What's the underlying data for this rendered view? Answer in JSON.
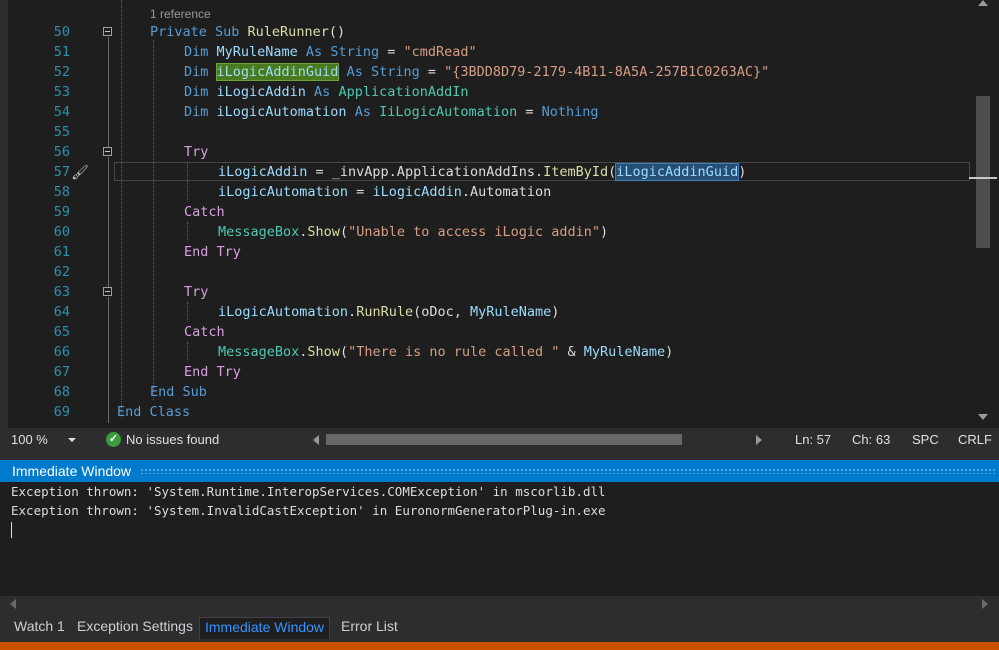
{
  "editor": {
    "reference_hint": "1 reference",
    "lines": [
      {
        "num": "50",
        "parts": [
          [
            "kw",
            "Private Sub "
          ],
          [
            "fn",
            "RuleRunner"
          ],
          [
            "plain",
            "()"
          ]
        ]
      },
      {
        "num": "51",
        "parts": [
          [
            "kw",
            "Dim "
          ],
          [
            "id",
            "MyRuleName"
          ],
          [
            "kw",
            " As "
          ],
          [
            "kw",
            "String"
          ],
          [
            "plain",
            " = "
          ],
          [
            "str",
            "\"cmdRead\""
          ]
        ]
      },
      {
        "num": "52",
        "parts": [
          [
            "kw",
            "Dim "
          ],
          [
            "id-hlg",
            "iLogicAddinGuid"
          ],
          [
            "kw",
            " As "
          ],
          [
            "kw",
            "String"
          ],
          [
            "plain",
            " = "
          ],
          [
            "str",
            "\"{3BDD8D79-2179-4B11-8A5A-257B1C0263AC}\""
          ]
        ]
      },
      {
        "num": "53",
        "parts": [
          [
            "kw",
            "Dim "
          ],
          [
            "id",
            "iLogicAddin"
          ],
          [
            "kw",
            " As "
          ],
          [
            "typ",
            "ApplicationAddIn"
          ]
        ]
      },
      {
        "num": "54",
        "parts": [
          [
            "kw",
            "Dim "
          ],
          [
            "id",
            "iLogicAutomation"
          ],
          [
            "kw",
            " As "
          ],
          [
            "typ",
            "IiLogicAutomation"
          ],
          [
            "plain",
            " = "
          ],
          [
            "kw",
            "Nothing"
          ]
        ]
      },
      {
        "num": "55",
        "parts": []
      },
      {
        "num": "56",
        "parts": [
          [
            "ctl",
            "Try"
          ]
        ]
      },
      {
        "num": "57",
        "parts": [
          [
            "id",
            "iLogicAddin"
          ],
          [
            "plain",
            " = _invApp.ApplicationAddIns."
          ],
          [
            "fn",
            "ItemById"
          ],
          [
            "plain",
            "("
          ],
          [
            "id-hlb",
            "iLogicAddinGuid"
          ],
          [
            "plain",
            ")"
          ]
        ]
      },
      {
        "num": "58",
        "parts": [
          [
            "id",
            "iLogicAutomation"
          ],
          [
            "plain",
            " = "
          ],
          [
            "id",
            "iLogicAddin"
          ],
          [
            "plain",
            ".Automation"
          ]
        ]
      },
      {
        "num": "59",
        "parts": [
          [
            "ctl",
            "Catch"
          ]
        ]
      },
      {
        "num": "60",
        "parts": [
          [
            "typ",
            "MessageBox"
          ],
          [
            "plain",
            "."
          ],
          [
            "fn",
            "Show"
          ],
          [
            "plain",
            "("
          ],
          [
            "str",
            "\"Unable to access iLogic addin\""
          ],
          [
            "plain",
            ")"
          ]
        ]
      },
      {
        "num": "61",
        "parts": [
          [
            "ctl",
            "End Try"
          ]
        ]
      },
      {
        "num": "62",
        "parts": []
      },
      {
        "num": "63",
        "parts": [
          [
            "ctl",
            "Try"
          ]
        ]
      },
      {
        "num": "64",
        "parts": [
          [
            "id",
            "iLogicAutomation"
          ],
          [
            "plain",
            "."
          ],
          [
            "fn",
            "RunRule"
          ],
          [
            "plain",
            "(oDoc, "
          ],
          [
            "id",
            "MyRuleName"
          ],
          [
            "plain",
            ")"
          ]
        ]
      },
      {
        "num": "65",
        "parts": [
          [
            "ctl",
            "Catch"
          ]
        ]
      },
      {
        "num": "66",
        "parts": [
          [
            "typ",
            "MessageBox"
          ],
          [
            "plain",
            "."
          ],
          [
            "fn",
            "Show"
          ],
          [
            "plain",
            "("
          ],
          [
            "str",
            "\"There is no rule called \""
          ],
          [
            "plain",
            " & "
          ],
          [
            "id",
            "MyRuleName"
          ],
          [
            "plain",
            ")"
          ]
        ]
      },
      {
        "num": "67",
        "parts": [
          [
            "ctl",
            "End Try"
          ]
        ]
      },
      {
        "num": "68",
        "parts": [
          [
            "kw",
            "End Sub"
          ]
        ]
      },
      {
        "num": "69",
        "parts": [
          [
            "kw",
            "End Class"
          ]
        ]
      }
    ]
  },
  "status": {
    "zoom": "100 %",
    "issues": "No issues found",
    "ln": "Ln: 57",
    "ch": "Ch: 63",
    "spc": "SPC",
    "crlf": "CRLF"
  },
  "immediate": {
    "title": "Immediate Window",
    "lines": [
      "Exception thrown: 'System.Runtime.InteropServices.COMException' in mscorlib.dll",
      "Exception thrown: 'System.InvalidCastException' in EuronormGeneratorPlug-in.exe"
    ]
  },
  "tabs": [
    "Watch 1",
    "Exception Settings",
    "Immediate Window",
    "Error List"
  ],
  "active_tab": "Immediate Window",
  "colors": {
    "keyword": "#569cd6",
    "control": "#d8a0df",
    "string": "#d69d85",
    "type": "#4ec9b0",
    "identifier": "#9cdcfe",
    "method": "#dcdcaa",
    "accent": "#007acc",
    "status_ok": "#3a9c3a"
  }
}
